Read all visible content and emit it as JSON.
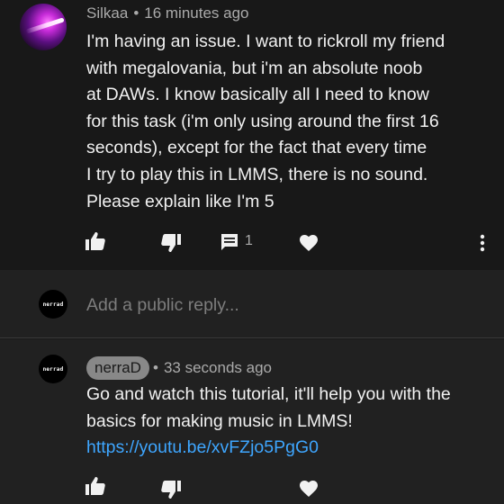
{
  "comment": {
    "author": "Silkaa",
    "separator": "•",
    "time": "16 minutes ago",
    "lines": [
      "I'm having an issue. I want to rickroll my friend",
      "with megalovania, but i'm an absolute noob",
      "at DAWs. I know basically all I need to know",
      "for this task (i'm only using around the first 16",
      "seconds), except for the fact that every time",
      "I try to play this in LMMS, there is no sound.",
      "Please explain like I'm 5"
    ],
    "reply_count": "1",
    "icons": [
      "thumb-up-icon",
      "thumb-down-icon",
      "comment-icon",
      "heart-icon",
      "more-vert-icon"
    ]
  },
  "reply_box": {
    "avatar_text": "nerrad",
    "placeholder": "Add a public reply..."
  },
  "reply": {
    "avatar_text": "nerrad",
    "author": "nerraD",
    "separator": "•",
    "time": "33 seconds ago",
    "lines": [
      "Go and watch this tutorial, it'll help you with the",
      "basics for making music in LMMS!"
    ],
    "link": "https://youtu.be/xvFZjo5PgG0",
    "icons": [
      "thumb-up-icon",
      "thumb-down-icon",
      "heart-icon"
    ]
  },
  "colors": {
    "background": "#181818",
    "reply_background": "#212121",
    "text": "#f1f1f1",
    "meta_text": "#aaaaaa",
    "link": "#3ea6ff",
    "author_chip": "#888888"
  }
}
